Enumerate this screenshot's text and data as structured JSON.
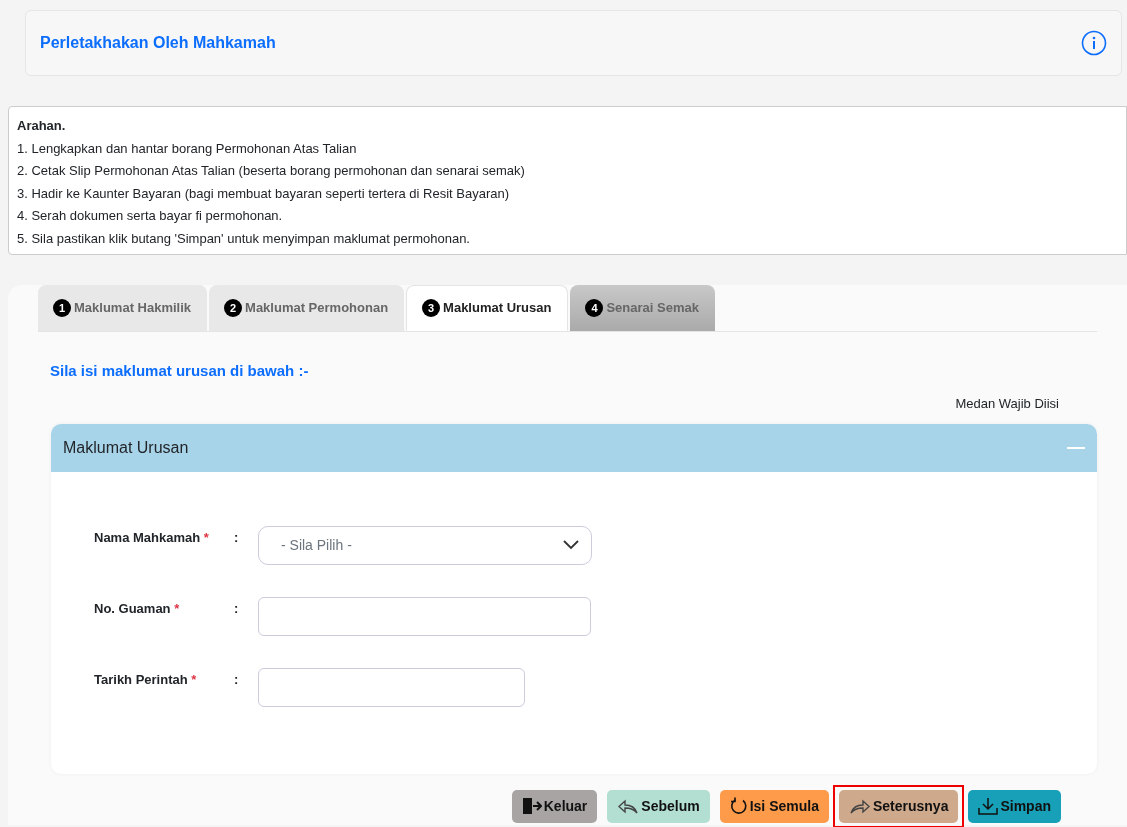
{
  "header": {
    "title": "Perletakhakan Oleh Mahkamah"
  },
  "instructions": {
    "title": "Arahan.",
    "lines": [
      "1. Lengkapkan dan hantar borang Permohonan Atas Talian",
      "2. Cetak Slip Permohonan Atas Talian (beserta borang permohonan dan senarai semak)",
      "3. Hadir ke Kaunter Bayaran (bagi membuat bayaran seperti tertera di Resit Bayaran)",
      "4. Serah dokumen serta bayar fi permohonan.",
      "5. Sila pastikan klik butang 'Simpan' untuk menyimpan maklumat permohonan."
    ]
  },
  "tabs": [
    {
      "number": "1",
      "label": "Maklumat Hakmilik",
      "selected": false,
      "disabled": false
    },
    {
      "number": "2",
      "label": "Maklumat Permohonan",
      "selected": false,
      "disabled": false
    },
    {
      "number": "3",
      "label": "Maklumat Urusan",
      "selected": true,
      "disabled": false
    },
    {
      "number": "4",
      "label": "Senarai Semak",
      "selected": false,
      "disabled": true
    }
  ],
  "subtitle": "Sila isi maklumat urusan di bawah :-",
  "required_note": "Medan Wajib Diisi",
  "panel": {
    "title": "Maklumat Urusan",
    "expanded": true,
    "fields": [
      {
        "kind": "select",
        "label": "Nama Mahkamah",
        "required_mark": "*",
        "separator": ":",
        "placeholder": "- Sila Pilih -"
      },
      {
        "kind": "text",
        "label": "No. Guaman",
        "required_mark": "*",
        "separator": ":"
      },
      {
        "kind": "date",
        "label": "Tarikh Perintah",
        "required_mark": "*",
        "separator": ":"
      }
    ]
  },
  "buttons": [
    {
      "kind": "exit",
      "label": "Keluar",
      "highlighted": false
    },
    {
      "kind": "back",
      "label": "Sebelum",
      "highlighted": false
    },
    {
      "kind": "reset",
      "label": "Isi Semula",
      "highlighted": false
    },
    {
      "kind": "next",
      "label": "Seterusnya",
      "highlighted": true
    },
    {
      "kind": "save",
      "label": "Simpan",
      "highlighted": false
    }
  ]
}
